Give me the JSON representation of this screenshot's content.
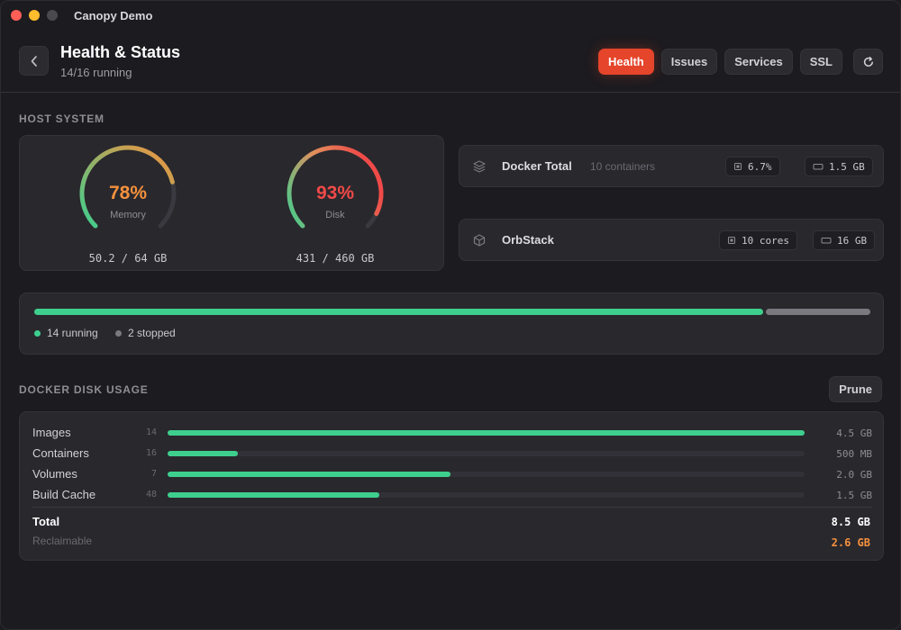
{
  "window": {
    "title": "Canopy Demo"
  },
  "header": {
    "title": "Health & Status",
    "subtitle": "14/16 running",
    "tabs": [
      {
        "label": "Health",
        "active": true
      },
      {
        "label": "Issues",
        "active": false
      },
      {
        "label": "Services",
        "active": false
      },
      {
        "label": "SSL",
        "active": false
      }
    ]
  },
  "host": {
    "section_label": "HOST SYSTEM",
    "memory": {
      "value": "78%",
      "label": "Memory",
      "usage": "50.2 / 64 GB",
      "fraction": 0.78,
      "color": "#f5913d"
    },
    "disk": {
      "value": "93%",
      "label": "Disk",
      "usage": "431 / 460 GB",
      "fraction": 0.93,
      "color": "#f04a48"
    },
    "docker_total": {
      "name": "Docker Total",
      "meta": "10 containers",
      "cpu": "6.7%",
      "memory": "1.5 GB"
    },
    "orbstack": {
      "name": "OrbStack",
      "cores": "10 cores",
      "memory": "16 GB"
    }
  },
  "containers": {
    "running": 14,
    "stopped": 2,
    "running_label": "14 running",
    "stopped_label": "2 stopped",
    "running_color": "#3ecf8e",
    "stopped_color": "#7a797f"
  },
  "disk_usage": {
    "section_label": "DOCKER DISK USAGE",
    "prune_label": "Prune",
    "rows": [
      {
        "label": "Images",
        "count": "14",
        "size": "4.5 GB",
        "fraction": 1.0
      },
      {
        "label": "Containers",
        "count": "16",
        "size": "500 MB",
        "fraction": 0.11
      },
      {
        "label": "Volumes",
        "count": "7",
        "size": "2.0 GB",
        "fraction": 0.444
      },
      {
        "label": "Build Cache",
        "count": "48",
        "size": "1.5 GB",
        "fraction": 0.333
      }
    ],
    "total_label": "Total",
    "total_value": "8.5 GB",
    "reclaim_label": "Reclaimable",
    "reclaim_value": "2.6 GB"
  },
  "colors": {
    "accent": "#e5452b",
    "green": "#3ecf8e",
    "orange": "#f5913d",
    "red": "#f04a48"
  }
}
